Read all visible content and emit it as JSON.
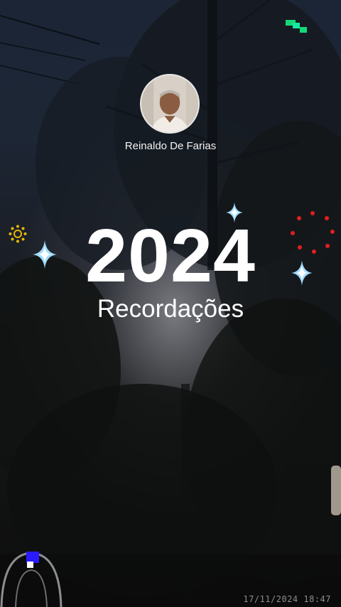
{
  "user": {
    "name": "Reinaldo De Farias"
  },
  "recap": {
    "year": "2024",
    "title": "Recordações"
  },
  "overlay": {
    "timestamp": "17/11/2024  18:47"
  },
  "icons": {
    "left_decor": "sun-icon",
    "right_decor": "dot-ring-icon",
    "sparkles": "sparkle-icon"
  },
  "colors": {
    "text": "#ffffff",
    "sun": "#e6b800",
    "dot_ring": "#e0201c",
    "corner_indicator": "#2a1bff",
    "top_decor": "#14d978"
  }
}
